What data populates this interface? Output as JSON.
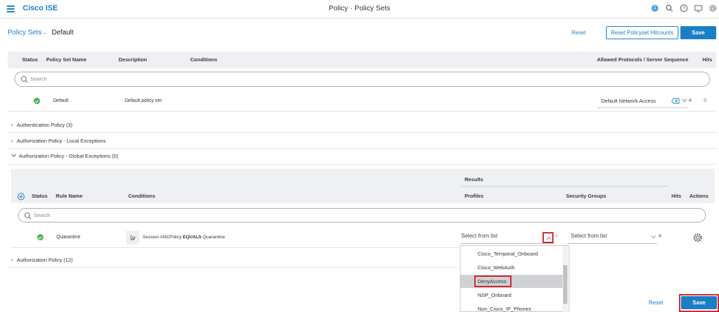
{
  "header": {
    "brand": "Cisco ISE",
    "title": "Policy · Policy Sets",
    "badge": "1"
  },
  "breadcrumb": {
    "link": "Policy Sets",
    "arrow": "→",
    "current": "Default"
  },
  "actions": {
    "reset": "Reset",
    "reset_hitcounts": "Reset Policyset Hitcounts",
    "save": "Save"
  },
  "policy_table": {
    "headers": {
      "status": "Status",
      "name": "Policy Set Name",
      "description": "Description",
      "conditions": "Conditions",
      "allowed": "Allowed Protocols / Server Sequence",
      "hits": "Hits"
    },
    "search_placeholder": "Search",
    "row": {
      "name": "Default",
      "description": "Default policy set",
      "allowed_protocols": "Default Network Access",
      "hits": "0"
    }
  },
  "sections": {
    "authentication": "Authentication Policy (3)",
    "local_exceptions": "Authorization Policy - Local Exceptions",
    "global_exceptions": "Authorization Policy - Global Exceptions (0)",
    "authorization": "Authorization Policy (12)"
  },
  "rules_table": {
    "results_label": "Results",
    "headers": {
      "status": "Status",
      "rule_name": "Rule Name",
      "conditions": "Conditions",
      "profiles": "Profiles",
      "security_groups": "Security Groups",
      "hits": "Hits",
      "actions": "Actions"
    },
    "search_placeholder": "Search",
    "row": {
      "name": "Quarantine",
      "condition_attr": "Session·ANCPolicy",
      "condition_op": "EQUALS",
      "condition_val": "Quarantine",
      "profiles_placeholder": "Select from list",
      "security_groups_placeholder": "Select from list"
    }
  },
  "dropdown": {
    "options": [
      "Cisco_Temporal_Onboard",
      "Cisco_WebAuth",
      "DenyAccess",
      "NSP_Onboard",
      "Non_Cisco_IP_Phones"
    ],
    "highlighted": "DenyAccess"
  },
  "footer": {
    "reset": "Reset",
    "save": "Save"
  },
  "colors": {
    "accent": "#1b7fc6",
    "success": "#4caf50",
    "highlight_box": "#d0282e"
  }
}
